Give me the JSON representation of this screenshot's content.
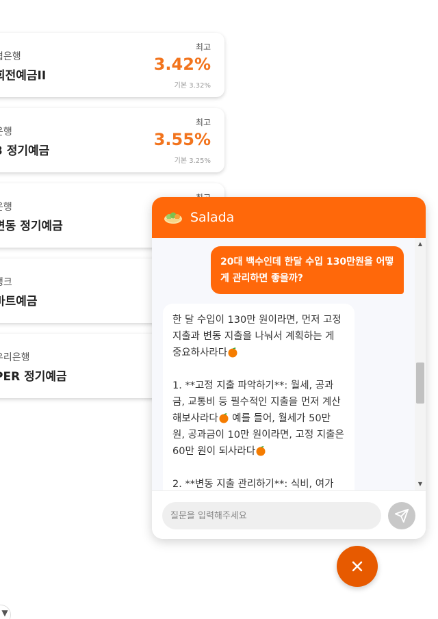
{
  "products": [
    {
      "bank": "협은행",
      "name": "회전예금II",
      "top_label": "최고",
      "rate": "3.42%",
      "base": "기본 3.32%"
    },
    {
      "bank": "은행",
      "name": "3 정기예금",
      "top_label": "최고",
      "rate": "3.55%",
      "base": "기본 3.25%"
    },
    {
      "bank": "은행",
      "name": "변동 정기예금",
      "top_label": "최고",
      "rate": "",
      "base": ""
    },
    {
      "bank": "뱅크",
      "name": "마트예금",
      "top_label": "",
      "rate": "",
      "base": ""
    },
    {
      "bank": "우리은행",
      "name": "PER 정기예금",
      "top_label": "",
      "rate": "",
      "base": ""
    }
  ],
  "chat": {
    "title": "Salada",
    "user_message": "20대 백수인데 한달 수입 130만원을 어떻게 관리하면 좋을까?",
    "bot_segments": [
      "한 달 수입이 130만 원이라면, 먼저 고정 지출과 변동 지출을 나눠서 계획하는 게 중요하사라다",
      "\n\n1. **고정 지출 파악하기**: 월세, 공과금, 교통비 등 필수적인 지출을 먼저 계산해보사라다",
      " 예를 들어, 월세가 50만 원, 공과금이 10만 원이라면, 고정 지출은 60만 원이 되사라다",
      "\n\n2. **변동 지출 관리하기**: 식비, 여가"
    ],
    "input_placeholder": "질문을 입력해주세요",
    "input_value": ""
  },
  "icons": {
    "header_logo": "salad-bowl-icon",
    "emoji": "tangerine-icon",
    "send": "send-icon",
    "close": "close-icon"
  },
  "colors": {
    "brand": "#ff680a",
    "rate": "#f2741d",
    "close_button": "#e75a00"
  }
}
